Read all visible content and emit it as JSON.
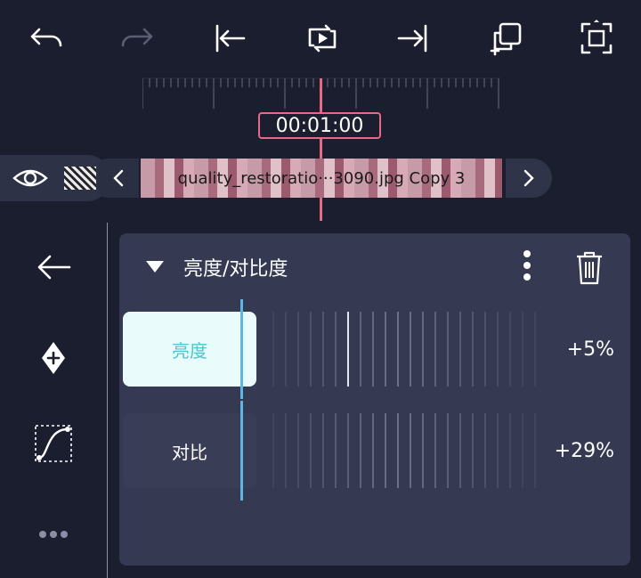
{
  "toolbar": {
    "undo_icon": "undo-icon",
    "redo_icon": "redo-icon",
    "jump_start_icon": "jump-to-start-icon",
    "play_loop_icon": "play-loop-icon",
    "jump_end_icon": "jump-to-end-icon",
    "copy_icon": "duplicate-icon",
    "fullscreen_icon": "fullscreen-icon"
  },
  "timeline": {
    "time": "00:01:00",
    "clip_label": "quality_restoratio···3090.jpg Copy 3"
  },
  "panel": {
    "title": "亮度/对比度",
    "rows": [
      {
        "label": "亮度",
        "value": "+5%"
      },
      {
        "label": "对比",
        "value": "+29%"
      }
    ]
  },
  "colors": {
    "background": "#1b1e2e",
    "panel": "#353a52",
    "accent_playhead": "#e46a86",
    "accent_slider": "#5db6e4",
    "active_label_bg": "#e9fcfb",
    "active_label_text": "#4fc3d1"
  }
}
